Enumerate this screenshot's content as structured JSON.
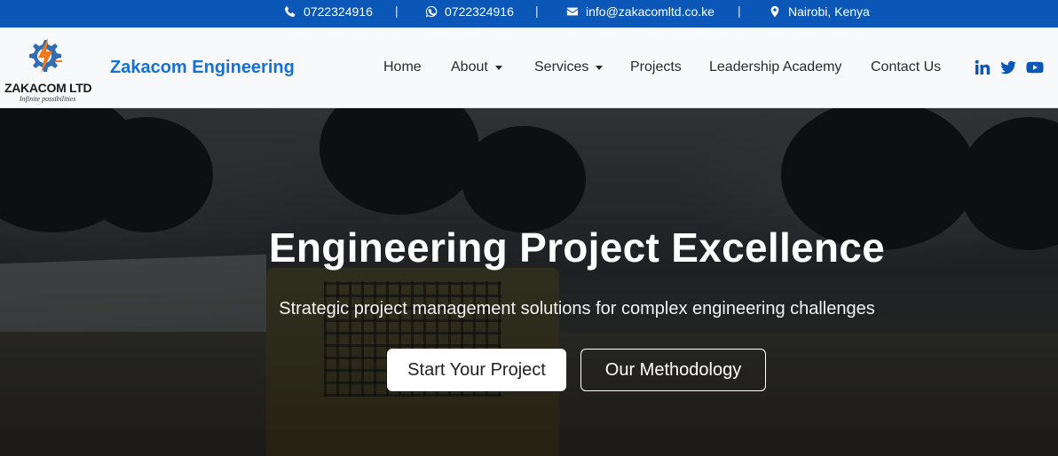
{
  "topbar": {
    "phone": "0722324916",
    "whatsapp": "0722324916",
    "email": "info@zakacomltd.co.ke",
    "location": "Nairobi, Kenya",
    "separator": "|",
    "icons": [
      "phone-icon",
      "whatsapp-icon",
      "envelope-icon",
      "map-marker-icon"
    ]
  },
  "logo": {
    "name": "ZAKACOM LTD",
    "tagline": "Infinite possibilities"
  },
  "brand": "Zakacom Engineering",
  "nav": {
    "items": [
      {
        "label": "Home",
        "dropdown": false
      },
      {
        "label": "About",
        "dropdown": true
      },
      {
        "label": "Services",
        "dropdown": true
      },
      {
        "label": "Projects",
        "dropdown": false
      },
      {
        "label": "Leadership Academy",
        "dropdown": false
      },
      {
        "label": "Contact Us",
        "dropdown": false
      }
    ],
    "social_icons": [
      "linkedin-icon",
      "twitter-icon",
      "youtube-icon"
    ]
  },
  "hero": {
    "title": "Engineering Project Excellence",
    "subtitle": "Strategic project management solutions for complex engineering challenges",
    "primary_button": "Start Your Project",
    "secondary_button": "Our Methodology"
  },
  "colors": {
    "topbar_bg": "#0a57b8",
    "brand_blue": "#1671d6",
    "navbar_bg": "#f8f9fa",
    "button_primary_bg": "#ffffff"
  }
}
